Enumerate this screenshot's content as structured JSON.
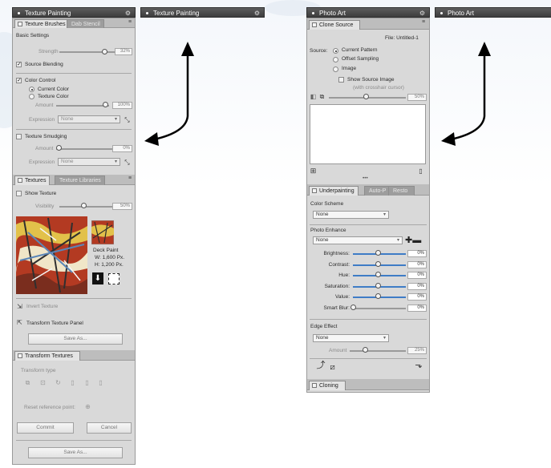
{
  "texture_painting": {
    "title": "Texture Painting",
    "collapsed_title": "Texture Painting",
    "tabs": [
      "Texture Brushes",
      "Dab Stencil"
    ],
    "basic_settings": {
      "heading": "Basic Settings",
      "strength_label": "Strength",
      "strength_value": "32%",
      "source_blending_label": "Source Blending"
    },
    "color_control": {
      "label": "Color Control",
      "current_color": "Current Color",
      "texture_color": "Texture Color",
      "amount_label": "Amount",
      "amount_value": "100%",
      "expression_label": "Expression",
      "expression_value": "None"
    },
    "texture_smudging": {
      "label": "Texture Smudging",
      "amount_label": "Amount",
      "amount_value": "0%",
      "expression_label": "Expression",
      "expression_value": "None"
    },
    "textures_tabs": [
      "Textures",
      "Texture Libraries"
    ],
    "show_texture_label": "Show Texture",
    "visibility_label": "Visibility",
    "visibility_value": "50%",
    "texture_name": "Deck Paint",
    "texture_w": "W: 1,600 Px.",
    "texture_h": "H: 1,200 Px.",
    "invert_texture": "Invert Texture",
    "transform_texture_panel": "Transform Texture Panel",
    "save_as_1": "Save As...",
    "transform_textures_tab": "Transform Textures",
    "transform_type_label": "Transform type",
    "reset_reference_point": "Reset reference point:",
    "commit": "Commit",
    "cancel": "Cancel",
    "save_as_2": "Save As..."
  },
  "photo_art": {
    "title": "Photo Art",
    "collapsed_title": "Photo Art",
    "clone_tab": "Clone Source",
    "file_label": "File: Untitled-1",
    "source_label": "Source:",
    "current_pattern": "Current Pattern",
    "offset_sampling": "Offset Sampling",
    "image": "Image",
    "show_source_image": "Show Source Image",
    "with_crosshair": "(with crosshair cursor)",
    "opacity_value": "50%",
    "bottom_tabs": [
      "Underpainting",
      "Auto-P",
      "Resto"
    ],
    "color_scheme_label": "Color Scheme",
    "color_scheme_value": "None",
    "photo_enhance_label": "Photo Enhance",
    "photo_enhance_value": "None",
    "sliders": [
      {
        "label": "Brightness:",
        "value": "0%"
      },
      {
        "label": "Contrast:",
        "value": "0%"
      },
      {
        "label": "Hue:",
        "value": "0%"
      },
      {
        "label": "Saturation:",
        "value": "0%"
      },
      {
        "label": "Value:",
        "value": "0%"
      },
      {
        "label": "Smart Blur:",
        "value": "0%"
      }
    ],
    "edge_effect_label": "Edge Effect",
    "edge_effect_value": "None",
    "amount_label": "Amount",
    "amount_value": "25%",
    "cloning_tab": "Cloning"
  },
  "colors": {
    "titlebar": "#4a4a4a",
    "panel_bg": "#d9d9d9",
    "accent_slider": "#3e7cc6",
    "arrow": "#000000"
  }
}
